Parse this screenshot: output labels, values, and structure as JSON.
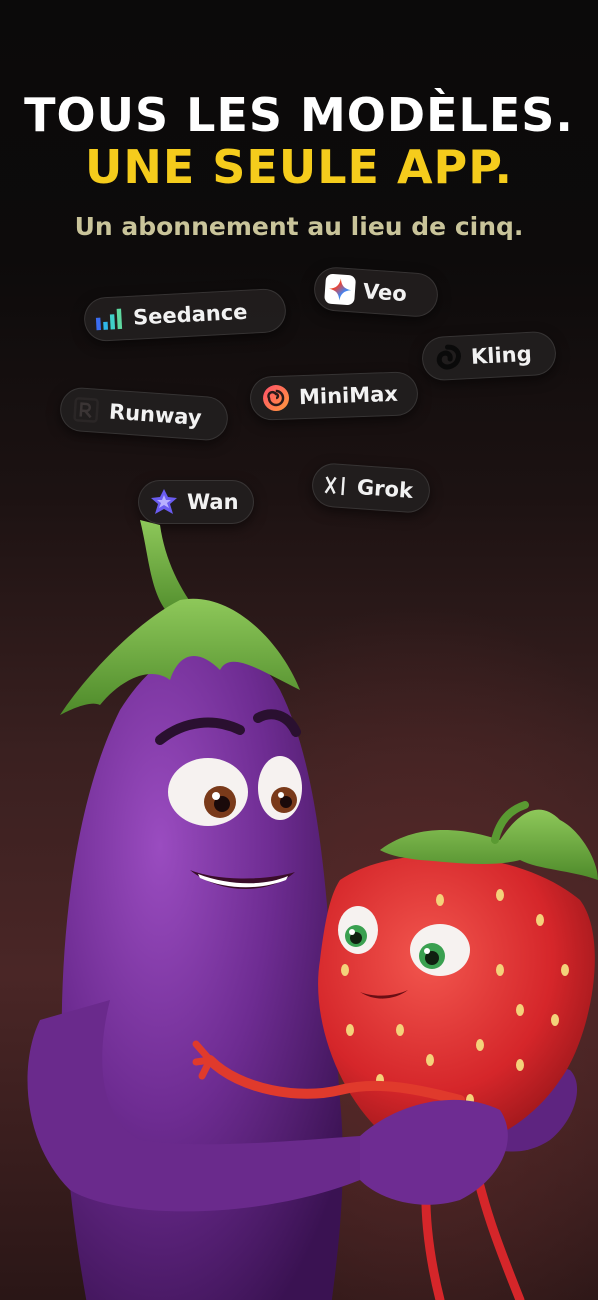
{
  "headline": {
    "line1": "TOUS LES MODÈLES.",
    "line2": "UNE SEULE APP."
  },
  "subtitle": "Un abonnement au lieu de cinq.",
  "colors": {
    "headline_primary": "#ffffff",
    "headline_accent": "#f5cc1c",
    "subtitle": "#c9c49a"
  },
  "models": [
    {
      "label": "Seedance",
      "icon": "seedance-bars-icon"
    },
    {
      "label": "Veo",
      "icon": "gemini-sparkle-icon"
    },
    {
      "label": "Kling",
      "icon": "kling-swirl-icon"
    },
    {
      "label": "Runway",
      "icon": "runway-logo-icon"
    },
    {
      "label": "MiniMax",
      "icon": "minimax-spiral-icon"
    },
    {
      "label": "Wan",
      "icon": "wan-star-icon"
    },
    {
      "label": "Grok",
      "icon": "grok-xai-icon"
    }
  ],
  "illustration": "eggplant-hugging-strawberry"
}
